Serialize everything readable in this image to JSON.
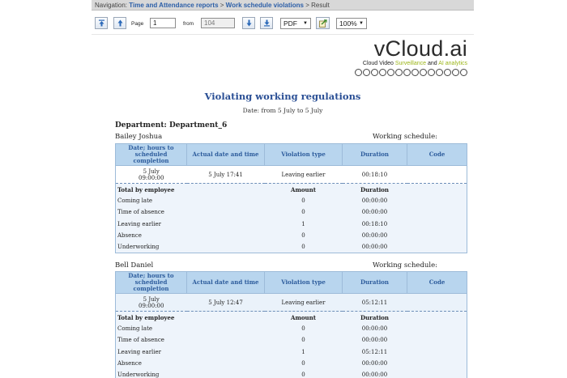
{
  "navigation": {
    "prefix": "Navigation:",
    "crumb1": "Time and Attendance reports",
    "sep": ">",
    "crumb2": "Work schedule violations",
    "current": "Result"
  },
  "toolbar": {
    "page_label": "Page",
    "page_value": "1",
    "from_label": "from",
    "total_pages": "104",
    "format_value": "PDF",
    "zoom_value": "100%"
  },
  "logo": {
    "brand": "vCloud.ai",
    "tagline_a": "Cloud Video ",
    "tagline_b": "Surveillance",
    "tagline_c": " and ",
    "tagline_d": "AI analytics"
  },
  "report": {
    "title": "Violating working regulations",
    "date_range": "Date: from 5 July to 5 July",
    "department": "Department: Department_6",
    "schedule_label": "Working schedule:",
    "headers": [
      "Date; hours to scheduled completion",
      "Actual date and time",
      "Violation type",
      "Duration",
      "Code"
    ],
    "summary_headers": [
      "Total by employee",
      "Amount",
      "Duration"
    ],
    "employees": [
      {
        "name": "Bailey Joshua",
        "violation": {
          "date": "5 July",
          "hours": "09:00:00",
          "actual": "5 July 17:41",
          "type": "Leaving earlier",
          "duration": "00:18:10",
          "code": ""
        },
        "totals": [
          {
            "label": "Coming late",
            "amount": "0",
            "duration": "00:00:00"
          },
          {
            "label": "Time of absence",
            "amount": "0",
            "duration": "00:00:00"
          },
          {
            "label": "Leaving earlier",
            "amount": "1",
            "duration": "00:18:10"
          },
          {
            "label": "Absence",
            "amount": "0",
            "duration": "00:00:00"
          },
          {
            "label": "Underworking",
            "amount": "0",
            "duration": "00:00:00"
          }
        ]
      },
      {
        "name": "Bell Daniel",
        "violation": {
          "date": "5 July",
          "hours": "09:00:00",
          "actual": "5 July 12:47",
          "type": "Leaving earlier",
          "duration": "05:12:11",
          "code": ""
        },
        "totals": [
          {
            "label": "Coming late",
            "amount": "0",
            "duration": "00:00:00"
          },
          {
            "label": "Time of absence",
            "amount": "0",
            "duration": "00:00:00"
          },
          {
            "label": "Leaving earlier",
            "amount": "1",
            "duration": "05:12:11"
          },
          {
            "label": "Absence",
            "amount": "0",
            "duration": "00:00:00"
          },
          {
            "label": "Underworking",
            "amount": "0",
            "duration": "00:00:00"
          }
        ]
      }
    ]
  }
}
